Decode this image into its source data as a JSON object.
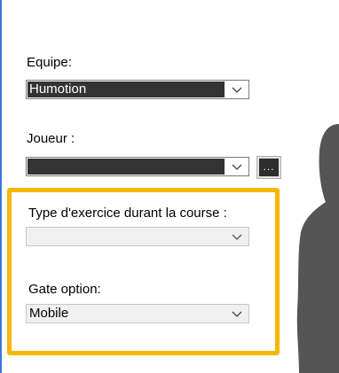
{
  "equipe": {
    "label": "Equipe:",
    "value": "Humotion"
  },
  "joueur": {
    "label": "Joueur :",
    "value": "",
    "browse_label": "..."
  },
  "exercise_type": {
    "label": "Type d'exercice durant la course :",
    "value": ""
  },
  "gate_option": {
    "label": "Gate option:",
    "value": "Mobile"
  },
  "colors": {
    "highlight": "#f5b800",
    "left_border": "#3b78d8",
    "silhouette": "#555555"
  },
  "icons": {
    "dropdown": "chevron-down-icon",
    "figure": "person-silhouette"
  }
}
